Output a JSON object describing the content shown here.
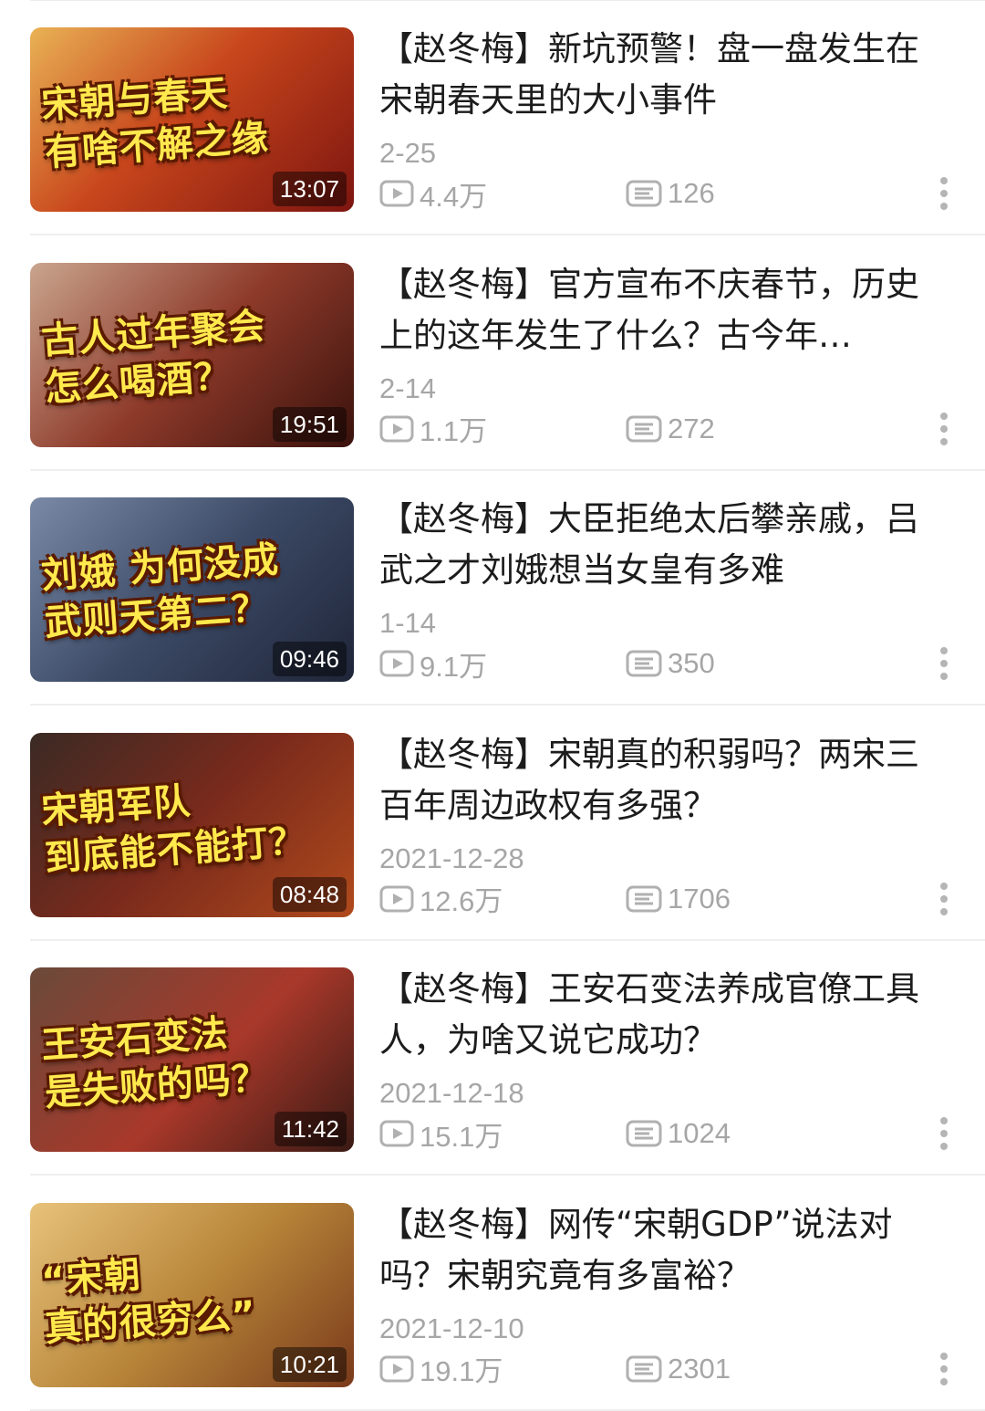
{
  "colors": {
    "title_text": "#1c1c1c",
    "meta_text": "#a6a6a6",
    "caption_yellow": "#ffe94d"
  },
  "icons": {
    "views": "play-icon",
    "danmaku": "danmaku-icon",
    "more": "more-vertical-icon"
  },
  "videos": [
    {
      "title": "【赵冬梅】新坑预警！盘一盘发生在宋朝春天里的大小事件",
      "date": "2-25",
      "views": "4.4万",
      "danmaku": "126",
      "duration": "13:07",
      "thumb_caption": "宋朝与春天\n有啥不解之缘",
      "thumb_bg": "linear-gradient(135deg,#e9b255 0%,#c8461c 45%,#7d1510 100%)"
    },
    {
      "title": "【赵冬梅】官方宣布不庆春节，历史上的这年发生了什么？古今年…",
      "date": "2-14",
      "views": "1.1万",
      "danmaku": "272",
      "duration": "19:51",
      "thumb_caption": "古人过年聚会\n怎么喝酒？",
      "thumb_bg": "linear-gradient(135deg,#c9a58e 0%,#8e3a2a 50%,#3a120c 100%)"
    },
    {
      "title": "【赵冬梅】大臣拒绝太后攀亲戚，吕武之才刘娥想当女皇有多难",
      "date": "1-14",
      "views": "9.1万",
      "danmaku": "350",
      "duration": "09:46",
      "thumb_caption": "刘娥 为何没成\n武则天第二？",
      "thumb_bg": "linear-gradient(135deg,#7a8aa6 0%,#3c4a66 50%,#1f2538 100%)"
    },
    {
      "title": "【赵冬梅】宋朝真的积弱吗？两宋三百年周边政权有多强？",
      "date": "2021-12-28",
      "views": "12.6万",
      "danmaku": "1706",
      "duration": "08:48",
      "thumb_caption": "宋朝军队\n到底能不能打？",
      "thumb_bg": "linear-gradient(135deg,#3a2a24 0%,#7a2a1c 50%,#b04a1c 100%)"
    },
    {
      "title": "【赵冬梅】王安石变法养成官僚工具人，为啥又说它成功？",
      "date": "2021-12-18",
      "views": "15.1万",
      "danmaku": "1024",
      "duration": "11:42",
      "thumb_caption": "王安石变法\n是失败的吗？",
      "thumb_bg": "linear-gradient(135deg,#6a4a3a 0%,#a8382a 55%,#3a1a14 100%)"
    },
    {
      "title": "【赵冬梅】网传“宋朝GDP”说法对吗？宋朝究竟有多富裕？",
      "date": "2021-12-10",
      "views": "19.1万",
      "danmaku": "2301",
      "duration": "10:21",
      "thumb_caption": "“宋朝\n真的很穷么”",
      "thumb_bg": "linear-gradient(135deg,#e8c27a 0%,#b8863a 50%,#7a3a1a 100%)"
    }
  ]
}
